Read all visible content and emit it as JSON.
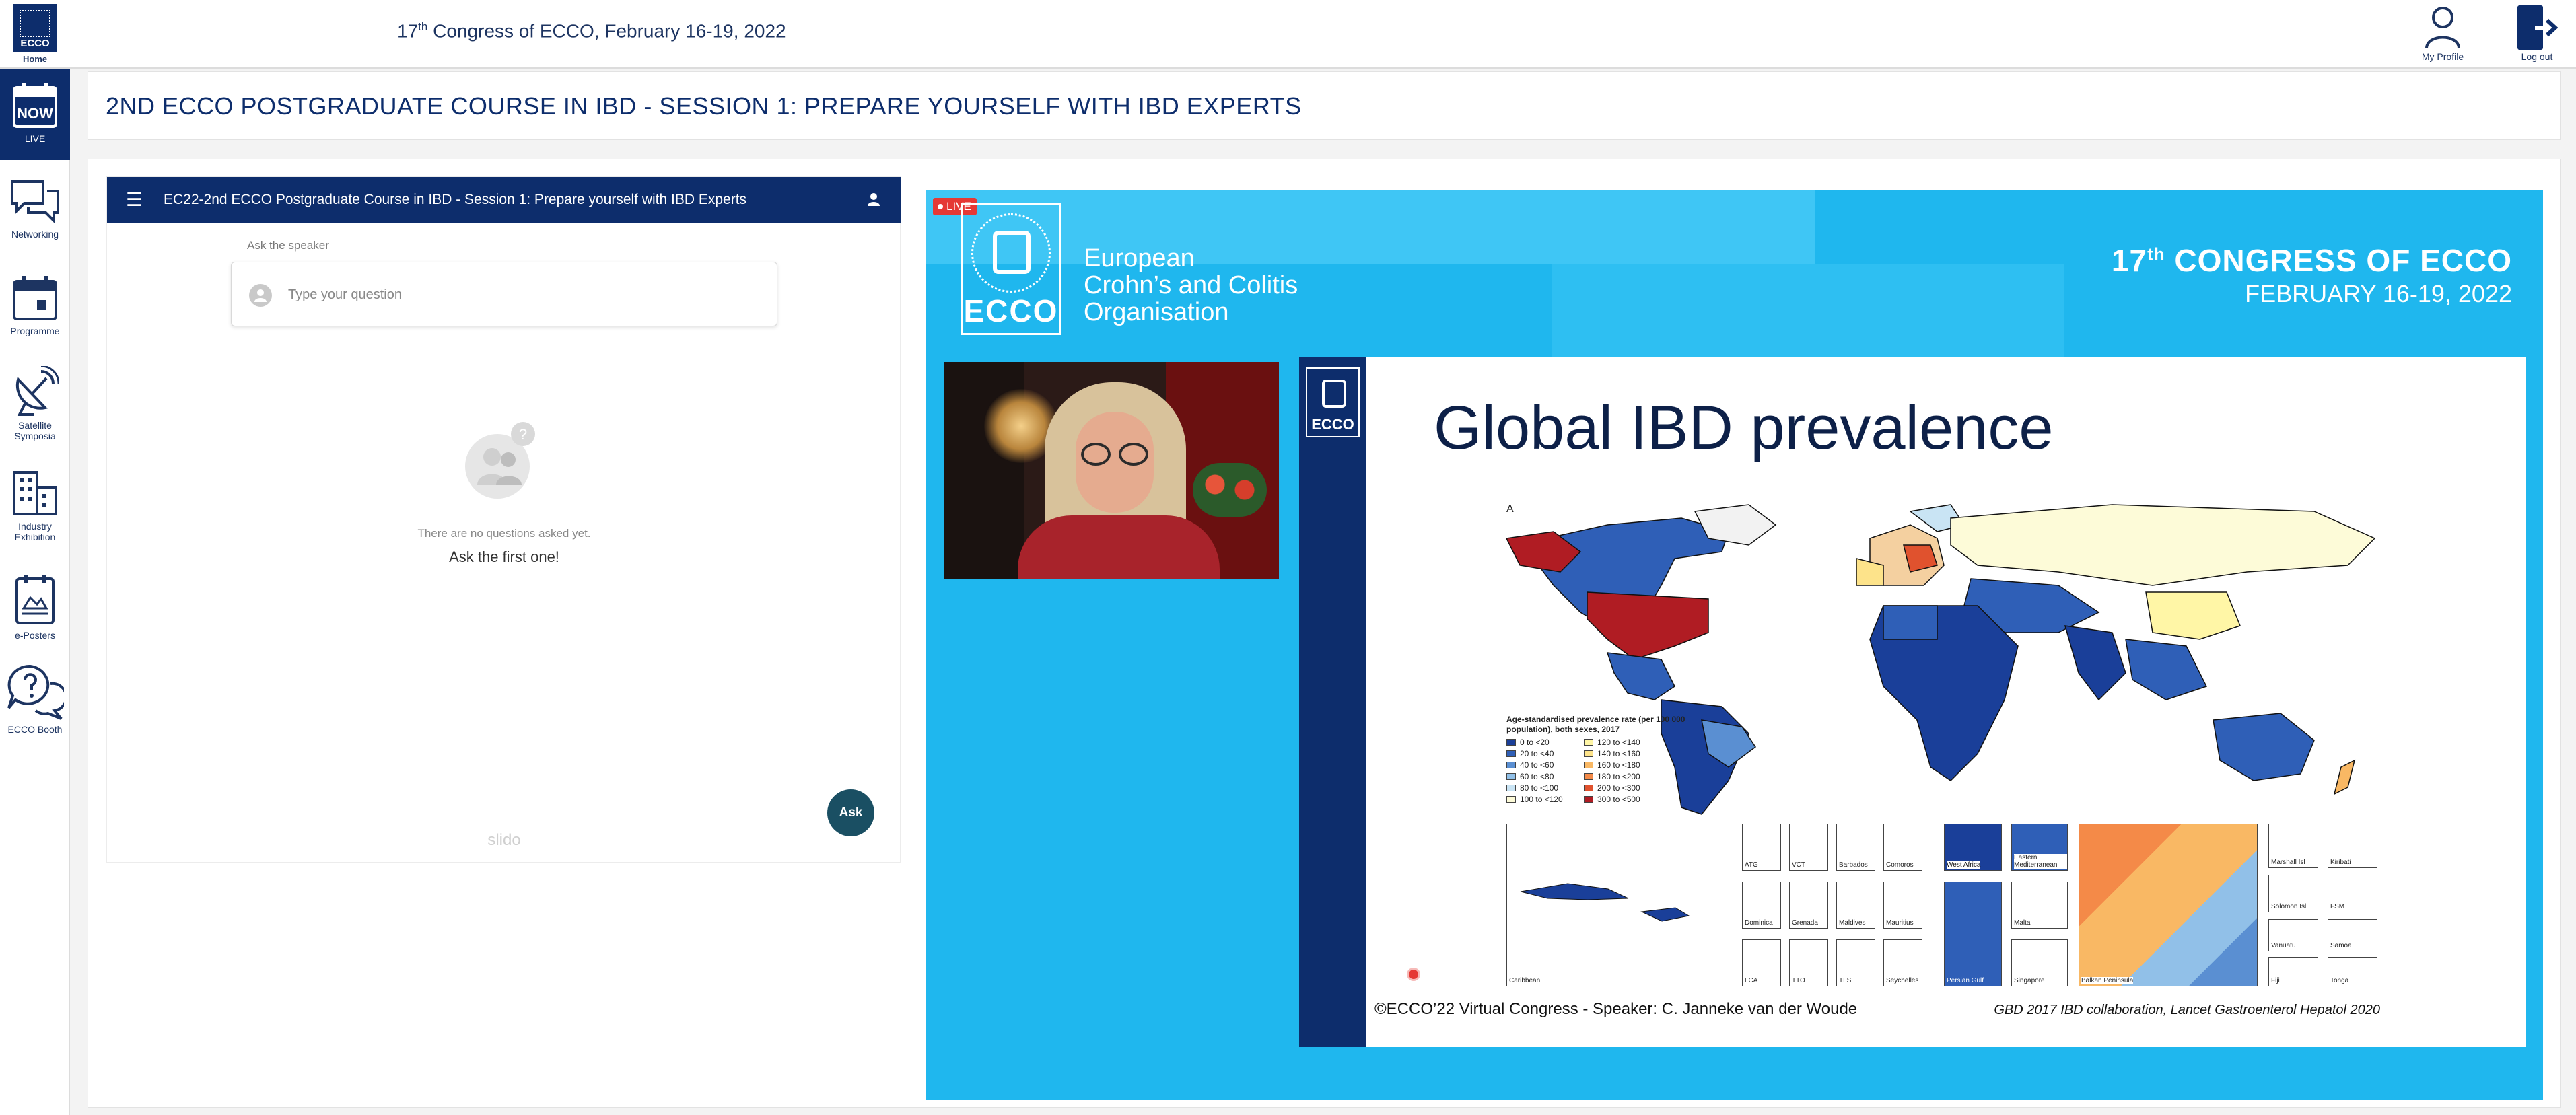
{
  "header": {
    "home_logo_text": "ECCO",
    "home_label": "Home",
    "congress_prefix": "17",
    "congress_sup": "th",
    "congress_suffix": " Congress of ECCO, February 16-19, 2022",
    "my_profile_label": "My Profile",
    "logout_label": "Log out"
  },
  "sidebar": {
    "items": [
      {
        "label": "LIVE",
        "icon": "now-live-icon",
        "icon_text": "NOW",
        "active": true
      },
      {
        "label": "Networking",
        "icon": "chat-bubbles-icon",
        "active": false
      },
      {
        "label": "Programme",
        "icon": "calendar-icon",
        "active": false
      },
      {
        "label": "Satellite Symposia",
        "icon": "satellite-icon",
        "active": false
      },
      {
        "label": "Industry Exhibition",
        "icon": "buildings-icon",
        "active": false
      },
      {
        "label": "e-Posters",
        "icon": "poster-icon",
        "active": false
      },
      {
        "label": "ECCO Booth",
        "icon": "question-bubbles-icon",
        "active": false
      }
    ]
  },
  "main": {
    "page_title": "2ND ECCO POSTGRADUATE COURSE IN IBD - SESSION 1: PREPARE YOURSELF WITH IBD EXPERTS"
  },
  "slido": {
    "header_title": "EC22-2nd ECCO Postgraduate Course in IBD - Session 1: Prepare yourself with IBD Experts",
    "ask_label": "Ask the speaker",
    "input_placeholder": "Type your question",
    "input_value": "",
    "empty_line1": "There are no questions asked yet.",
    "empty_line2": "Ask the first one!",
    "ask_button": "Ask",
    "brand": "slido"
  },
  "video": {
    "live_badge": "LIVE",
    "logo_word": "ECCO",
    "org_line1": "European",
    "org_line2": "Crohn’s and Colitis",
    "org_line3": "Organisation",
    "congress_prefix": "17",
    "congress_sup": "th",
    "congress_suffix": " CONGRESS OF ECCO",
    "congress_dates": "FEBRUARY 16-19, 2022",
    "slide": {
      "logo_word": "ECCO",
      "title": "Global IBD prevalence",
      "panel_letter": "A",
      "legend_title": "Age-standardised prevalence rate (per 100 000 population), both sexes, 2017",
      "legend": [
        {
          "label": "0 to <20",
          "color": "#1a3f99"
        },
        {
          "label": "120 to <140",
          "color": "#fff6a6"
        },
        {
          "label": "20 to <40",
          "color": "#2f5fb7"
        },
        {
          "label": "140 to <160",
          "color": "#fde38a"
        },
        {
          "label": "40 to <60",
          "color": "#5a8fd2"
        },
        {
          "label": "160 to <180",
          "color": "#f9b864"
        },
        {
          "label": "60 to <80",
          "color": "#91c0e8"
        },
        {
          "label": "180 to <200",
          "color": "#f48a48"
        },
        {
          "label": "80 to <100",
          "color": "#c9e4f4"
        },
        {
          "label": "200 to <300",
          "color": "#e0522e"
        },
        {
          "label": "100 to <120",
          "color": "#fdfbd8"
        },
        {
          "label": "300 to <500",
          "color": "#b01c23"
        }
      ],
      "insets": [
        "Caribbean",
        "ATG",
        "VCT",
        "Barbados",
        "Comoros",
        "West Africa",
        "Eastern Mediterranean",
        "Balkan Peninsula",
        "Marshall Isl",
        "Kiribati",
        "Dominica",
        "Grenada",
        "Maldives",
        "Mauritius",
        "Malta",
        "Solomon Isl",
        "FSM",
        "LCA",
        "TTO",
        "TLS",
        "Seychelles",
        "Persian Gulf",
        "Singapore",
        "Vanuatu",
        "Samoa",
        "Fiji",
        "Tonga"
      ],
      "footer": "©ECCO’22 Virtual Congress -  Speaker: C. Janneke van der Woude",
      "reference": "GBD 2017 IBD collaboration, Lancet Gastroenterol Hepatol 2020"
    }
  }
}
